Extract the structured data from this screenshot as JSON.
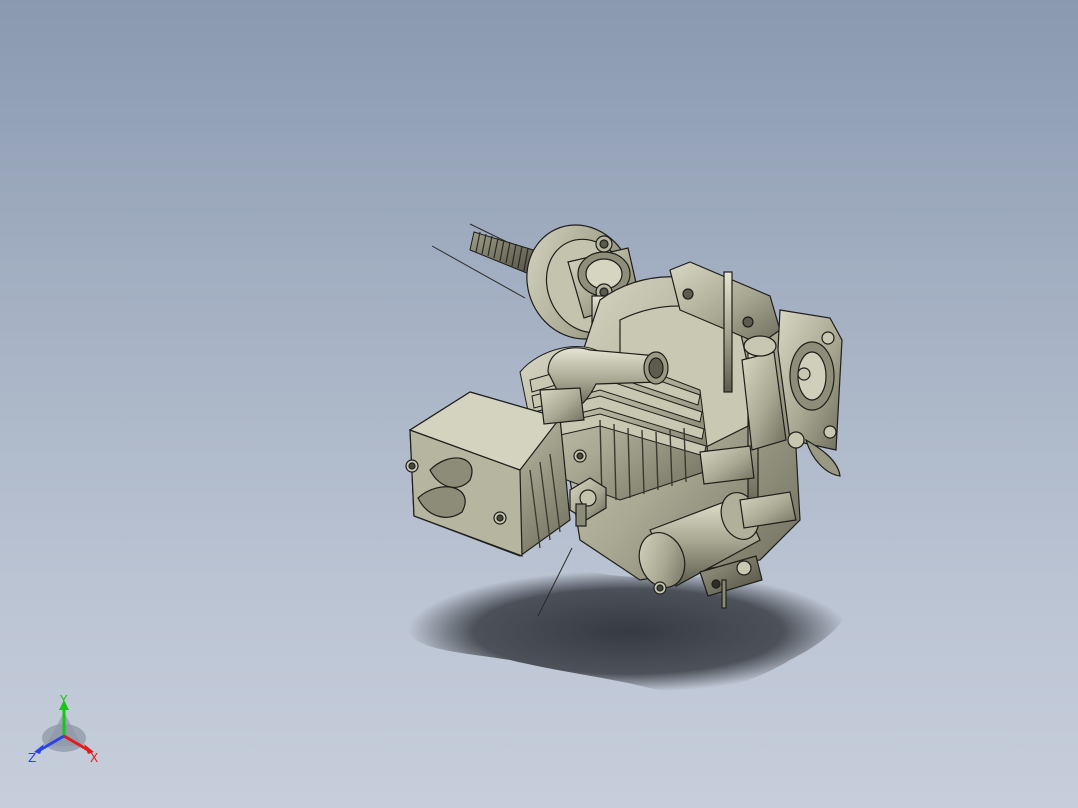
{
  "viewport": {
    "background_top": "#8a99b0",
    "background_bottom": "#c6cedb",
    "model": "engine-assembly-model"
  },
  "triad": {
    "x_label": "X",
    "y_label": "Y",
    "z_label": "Z",
    "x_color": "#e11b1b",
    "y_color": "#19c419",
    "z_color": "#2a44e6"
  },
  "colors": {
    "part_fill": "#b3b29c",
    "part_dark": "#6f6e5e",
    "part_light": "#dcdbc8",
    "edge": "#1e1e1a",
    "shadow": "#2a2d33"
  }
}
